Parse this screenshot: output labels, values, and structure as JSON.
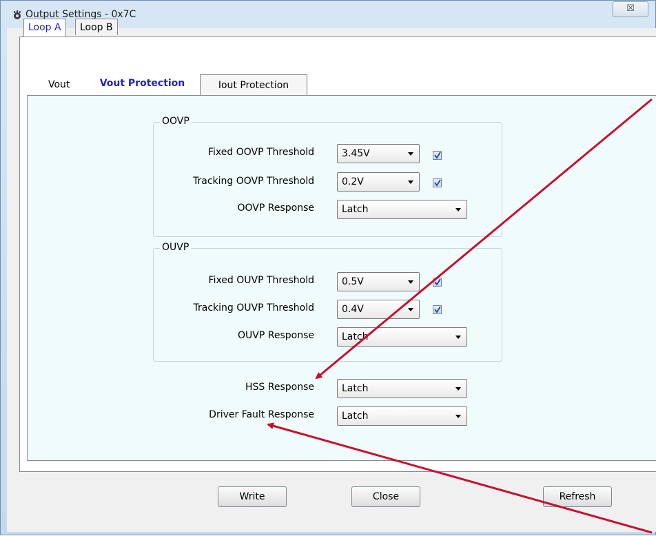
{
  "window": {
    "title": "Output Settings - 0x7C",
    "close_glyph": "☒"
  },
  "outer_tabs": [
    {
      "label": "Loop A"
    },
    {
      "label": "Loop B"
    }
  ],
  "inner_tabs": [
    {
      "label": "Vout"
    },
    {
      "label": "Vout Protection"
    },
    {
      "label": "Iout Protection"
    }
  ],
  "oovp": {
    "title": "OOVP",
    "fixed": {
      "label": "Fixed OOVP Threshold",
      "value": "3.45V",
      "checked": true
    },
    "tracking": {
      "label": "Tracking OOVP Threshold",
      "value": "0.2V",
      "checked": true
    },
    "response": {
      "label": "OOVP Response",
      "value": "Latch"
    }
  },
  "ouvp": {
    "title": "OUVP",
    "fixed": {
      "label": "Fixed OUVP Threshold",
      "value": "0.5V",
      "checked": true
    },
    "tracking": {
      "label": "Tracking OUVP Threshold",
      "value": "0.4V",
      "checked": true
    },
    "response": {
      "label": "OUVP Response",
      "value": "Latch"
    }
  },
  "hss": {
    "label": "HSS Response",
    "value": "Latch"
  },
  "driver_fault": {
    "label": "Driver Fault Response",
    "value": "Latch"
  },
  "buttons": {
    "write": "Write",
    "close": "Close",
    "refresh": "Refresh"
  },
  "colors": {
    "accent": "#1f1fd1",
    "annotation_arrow": "#c8102e",
    "panel_bg": "#f0fbfb"
  }
}
